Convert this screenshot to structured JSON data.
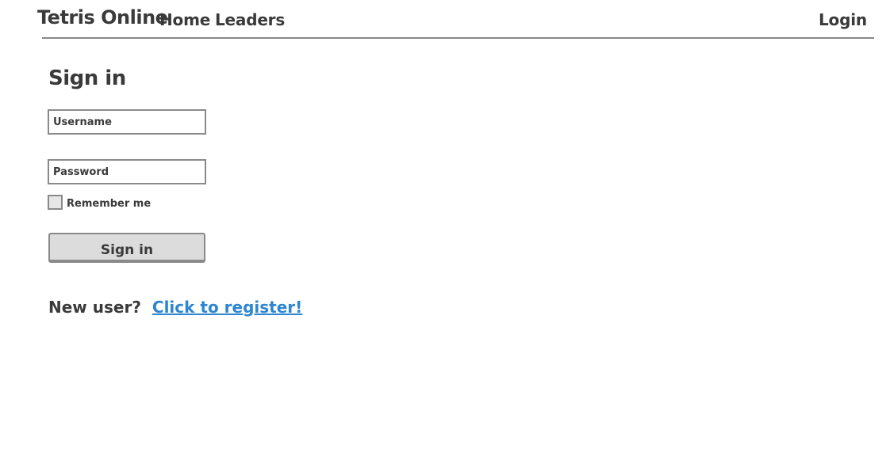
{
  "header": {
    "brand": "Tetris Online",
    "nav": {
      "home": "Home",
      "leaders": "Leaders",
      "login": "Login"
    }
  },
  "signin_form": {
    "title": "Sign in",
    "username_placeholder": "Username",
    "password_placeholder": "Password",
    "remember_label": "Remember me",
    "remember_checked": false,
    "submit_label": "Sign in"
  },
  "register": {
    "prompt": "New user?",
    "link_label": "Click to register!"
  },
  "colors": {
    "text": "#3a3a3a",
    "link": "#2d86cf",
    "border": "#8a8a8a",
    "button_bg": "#dcdcdc"
  }
}
